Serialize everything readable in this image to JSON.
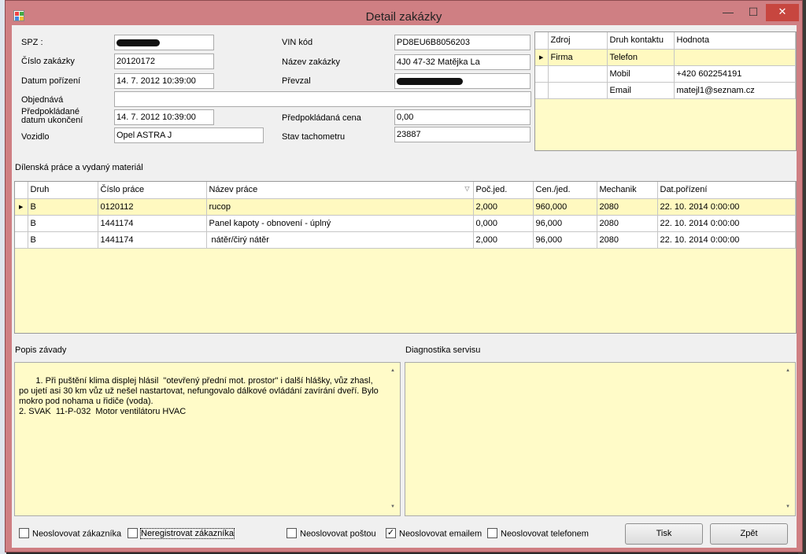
{
  "window": {
    "title": "Detail zakázky",
    "min_glyph": "—",
    "max_glyph": "☐",
    "close_glyph": "✕"
  },
  "form": {
    "spz_label": "SPZ :",
    "cislo_label": "Číslo zakázky",
    "cislo_value": "20120172",
    "datum_label": "Datum pořízení",
    "datum_value": "14. 7. 2012 10:39:00",
    "objednava_label": "Objednává",
    "objednava_value": "",
    "predpokl_label_1": "Předpokládané",
    "predpokl_label_2": "datum ukončení",
    "predpokl_value": "14. 7. 2012 10:39:00",
    "vozidlo_label": "Vozidlo",
    "vozidlo_value": "Opel ASTRA J",
    "vin_label": "VIN kód",
    "vin_value": "PD8EU6B8056203",
    "nazev_label": "Název zakázky",
    "nazev_value": "4J0 47-32 Matějka La",
    "prevzal_label": "Převzal",
    "cena_label": "Předpokládaná cena",
    "cena_value": "0,00",
    "stav_label": "Stav tachometru",
    "stav_value": "23887"
  },
  "contacts": {
    "columns": [
      "Zdroj",
      "Druh kontaktu",
      "Hodnota"
    ],
    "rows": [
      {
        "marker": "▶",
        "zdroj": "Firma",
        "druh": "Telefon",
        "hodnota": ""
      },
      {
        "marker": "",
        "zdroj": "",
        "druh": "Mobil",
        "hodnota": "+420 602254191"
      },
      {
        "marker": "",
        "zdroj": "",
        "druh": "Email",
        "hodnota": "matejl1@seznam.cz"
      }
    ]
  },
  "work": {
    "section_label": "Dílenská práce a vydaný materiál",
    "filter_glyph": "▽",
    "columns": [
      "Druh",
      "Číslo práce",
      "Název práce",
      "Poč.jed.",
      "Cen./jed.",
      "Mechanik",
      "Dat.pořízení"
    ],
    "rows": [
      {
        "marker": "▶",
        "druh": "B",
        "cislo": "0120112",
        "nazev": "rucop",
        "poc": "2,000",
        "cena": "960,000",
        "mech": "2080",
        "dat": "22. 10. 2014 0:00:00"
      },
      {
        "marker": "",
        "druh": "B",
        "cislo": "1441174",
        "nazev": "Panel kapoty - obnovení - úplný",
        "poc": "0,000",
        "cena": "96,000",
        "mech": "2080",
        "dat": "22. 10. 2014 0:00:00"
      },
      {
        "marker": "",
        "druh": "B",
        "cislo": "1441174",
        "nazev": " nátěr/čirý nátěr",
        "poc": "2,000",
        "cena": "96,000",
        "mech": "2080",
        "dat": "22. 10. 2014 0:00:00"
      }
    ]
  },
  "popis": {
    "label": "Popis závady",
    "text": " 1. Při puštění klima displej hlásil  \"otevřený přední mot. prostor\" i další hlášky, vůz zhasl, po ujetí asi 30 km vůz už nešel nastartovat, nefungovalo dálkové ovládání zavírání dveří. Bylo mokro pod nohama u řidiče (voda).\n2. SVAK  11-P-032  Motor ventilátoru HVAC"
  },
  "diagnostika": {
    "label": "Diagnostika servisu",
    "text": ""
  },
  "scroll_up": "▲",
  "scroll_down": "▼",
  "checkboxes": {
    "neoslovovat_zakaznika": {
      "label": "Neoslovovat zákazníka",
      "checked": false
    },
    "neregistrovat": {
      "label": "Neregistrovat zákazníka",
      "checked": false
    },
    "postou": {
      "label": "Neoslovovat poštou",
      "checked": false
    },
    "emailem": {
      "label": "Neoslovovat emailem",
      "checked": true,
      "mark": "✓"
    },
    "telefonem": {
      "label": "Neoslovovat telefonem",
      "checked": false
    }
  },
  "buttons": {
    "tisk": "Tisk",
    "zpet": "Zpět"
  }
}
